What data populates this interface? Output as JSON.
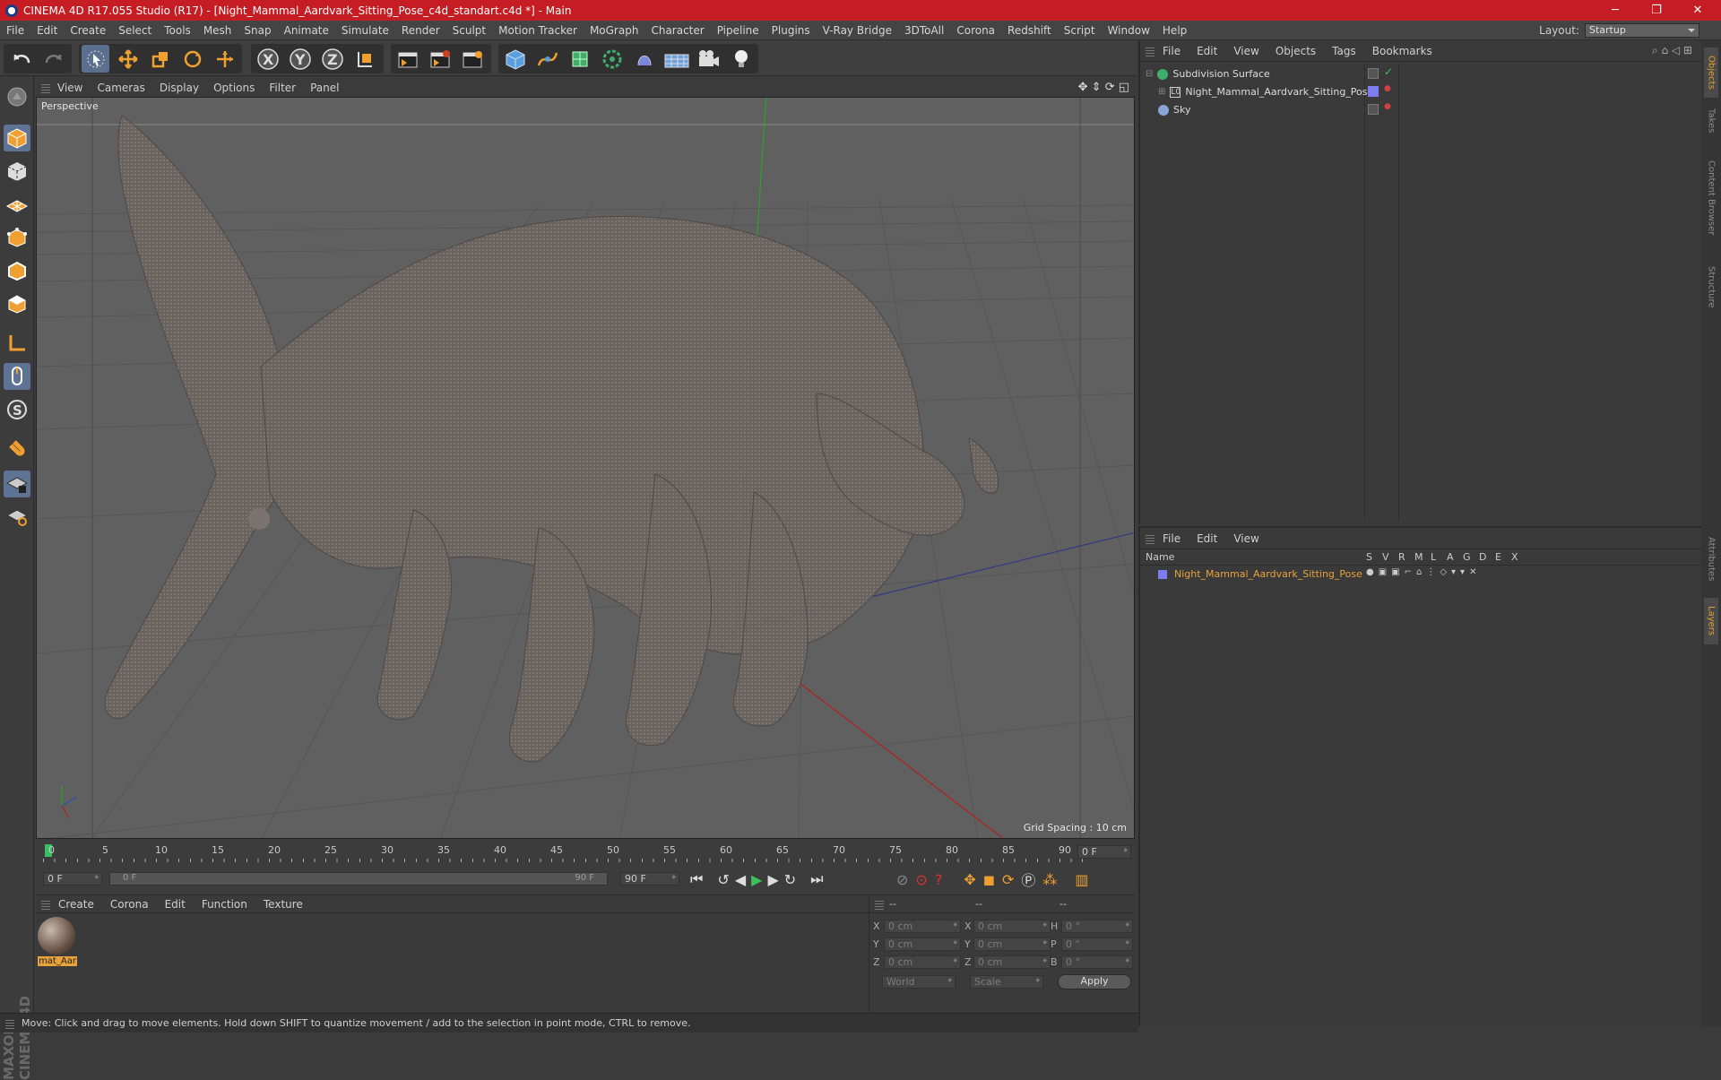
{
  "window": {
    "title": "CINEMA 4D R17.055 Studio (R17) - [Night_Mammal_Aardvark_Sitting_Pose_c4d_standart.c4d *] - Main",
    "min": "─",
    "max": "❐",
    "close": "✕"
  },
  "menubar": [
    "File",
    "Edit",
    "Create",
    "Select",
    "Tools",
    "Mesh",
    "Snap",
    "Animate",
    "Simulate",
    "Render",
    "Sculpt",
    "Motion Tracker",
    "MoGraph",
    "Character",
    "Pipeline",
    "Plugins",
    "V-Ray Bridge",
    "3DToAll",
    "Corona",
    "Redshift",
    "Script",
    "Window",
    "Help"
  ],
  "layout": {
    "label": "Layout:",
    "value": "Startup"
  },
  "viewport": {
    "menu": [
      "View",
      "Cameras",
      "Display",
      "Options",
      "Filter",
      "Panel"
    ],
    "label": "Perspective",
    "grid_spacing": "Grid Spacing : 10 cm"
  },
  "timeline": {
    "ticks": [
      "0",
      "5",
      "10",
      "15",
      "20",
      "25",
      "30",
      "35",
      "40",
      "45",
      "50",
      "55",
      "60",
      "65",
      "70",
      "75",
      "80",
      "85",
      "90"
    ],
    "current_frame": "0 F",
    "start": "0 F",
    "range_start": "0 F",
    "range_end": "90 F",
    "end": "90 F"
  },
  "materials": {
    "menu": [
      "Create",
      "Corona",
      "Edit",
      "Function",
      "Texture"
    ],
    "items": [
      {
        "name": "mat_Aar"
      }
    ]
  },
  "coords": {
    "headers": [
      "--",
      "--",
      "--"
    ],
    "rows": [
      {
        "a": "X",
        "av": "0 cm",
        "b": "X",
        "bv": "0 cm",
        "c": "H",
        "cv": "0 °"
      },
      {
        "a": "Y",
        "av": "0 cm",
        "b": "Y",
        "bv": "0 cm",
        "c": "P",
        "cv": "0 °"
      },
      {
        "a": "Z",
        "av": "0 cm",
        "b": "Z",
        "bv": "0 cm",
        "c": "B",
        "cv": "0 °"
      }
    ],
    "mode1": "World",
    "mode2": "Scale",
    "apply": "Apply"
  },
  "objects": {
    "menu": [
      "File",
      "Edit",
      "View",
      "Objects",
      "Tags",
      "Bookmarks"
    ],
    "items": [
      {
        "name": "Subdivision Surface"
      },
      {
        "name": "Night_Mammal_Aardvark_Sitting_Pose"
      },
      {
        "name": "Sky"
      }
    ]
  },
  "layers": {
    "menu": [
      "File",
      "Edit",
      "View"
    ],
    "columns": [
      "Name",
      "S",
      "V",
      "R",
      "M",
      "L",
      "A",
      "G",
      "D",
      "E",
      "X"
    ],
    "items": [
      {
        "name": "Night_Mammal_Aardvark_Sitting_Pose"
      }
    ]
  },
  "right_tabs": [
    "Objects",
    "Takes",
    "Content Browser",
    "Structure",
    "Attributes",
    "Layers"
  ],
  "branding": "MAXON CINEMA 4D",
  "status": "Move: Click and drag to move elements. Hold down SHIFT to quantize movement / add to the selection in point mode, CTRL to remove.",
  "colors": {
    "accent": "#e8a23a",
    "title_bar": "#c51d23",
    "selection": "#5b6f8f"
  }
}
